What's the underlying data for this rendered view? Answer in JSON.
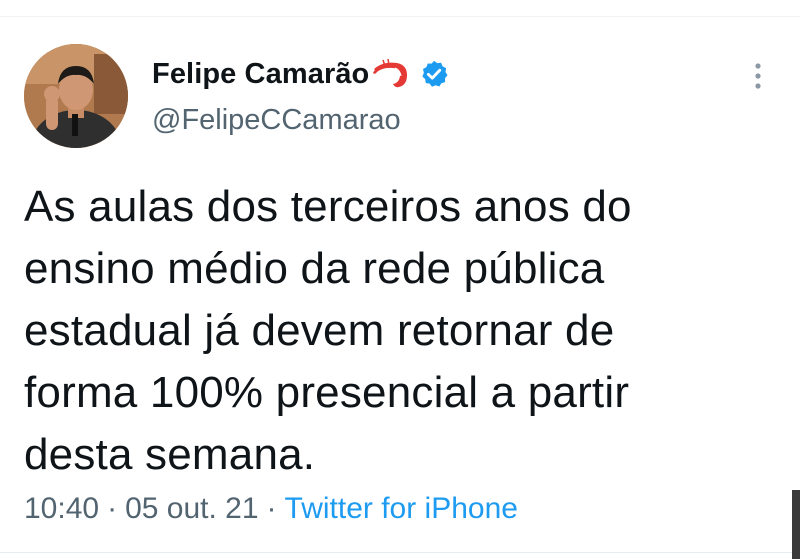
{
  "tweet": {
    "author": {
      "display_name": "Felipe Camarão",
      "handle": "@FelipeCCamarao",
      "name_emoji": "shrimp-icon",
      "verified_icon": "verified-badge-icon"
    },
    "text": "As aulas dos terceiros anos do\nensino médio da rede pública\nestadual já devem retornar de\nforma 100% presencial a partir\ndesta semana.",
    "meta": {
      "time": "10:40",
      "separator": "·",
      "date": "05 out. 21",
      "source": "Twitter for iPhone"
    },
    "more_icon": "more-vertical-icon"
  },
  "colors": {
    "text_primary": "#0f1419",
    "text_secondary": "#536471",
    "accent": "#1d9bf0"
  }
}
